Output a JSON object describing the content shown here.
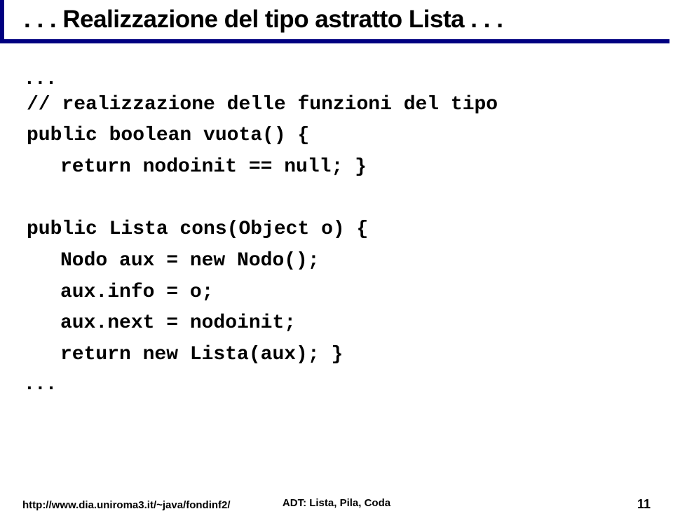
{
  "title": ". . . Realizzazione del tipo astratto Lista . . .",
  "code": {
    "dots_top": ".  .  .",
    "line1": "// realizzazione delle funzioni del tipo",
    "line2": "public boolean vuota() {",
    "line3": "return nodoinit == null; }",
    "line4": "public Lista cons(Object o) {",
    "line5": "Nodo aux = new Nodo();",
    "line6": "aux.info = o;",
    "line7": "aux.next = nodoinit;",
    "line8": "return new Lista(aux); }",
    "dots_bottom": ".  .  ."
  },
  "footer": {
    "left": "http://www.dia.uniroma3.it/~java/fondinf2/",
    "center": "ADT: Lista, Pila, Coda",
    "right": "11"
  }
}
